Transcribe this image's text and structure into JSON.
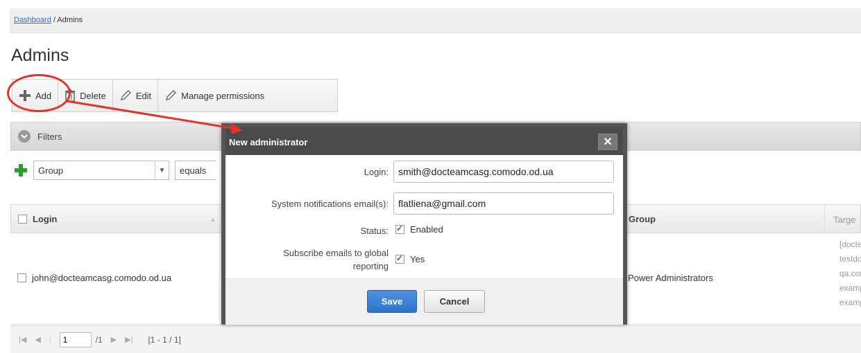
{
  "breadcrumb": {
    "link": "Dashboard",
    "separator": " / ",
    "current": "Admins"
  },
  "page_title": "Admins",
  "toolbar": {
    "add_label": "Add",
    "delete_label": "Delete",
    "edit_label": "Edit",
    "manage_label": "Manage permissions"
  },
  "filters": {
    "title": "Filters",
    "field_value": "Group",
    "operator_value": "equals"
  },
  "table": {
    "columns": [
      "Login",
      "Group",
      "Targe"
    ],
    "rows": [
      {
        "login": "john@docteamcasg.comodo.od.ua",
        "group": "Power Administrators",
        "targets": [
          "[docte",
          "testdo",
          "qa.cor",
          "examp",
          "examp"
        ]
      }
    ]
  },
  "pager": {
    "page_value": "1",
    "total_pages": "/1",
    "range": "[1 - 1 / 1]"
  },
  "modal": {
    "title": "New administrator",
    "close_label": "✕",
    "login_label": "Login:",
    "login_value": "smith@docteamcasg.comodo.od.ua",
    "email_label": "System notifications email(s):",
    "email_value": "flatliena@gmail.com",
    "status_label": "Status:",
    "status_value": "Enabled",
    "subscribe_label_line1": "Subscribe emails to global",
    "subscribe_label_line2": "reporting",
    "subscribe_value": "Yes",
    "save_label": "Save",
    "cancel_label": "Cancel"
  },
  "colors": {
    "annotation_red": "#e6332a",
    "save_blue": "#3a7fd4",
    "add_green": "#2e9e2e",
    "modal_header": "#4a4a4a"
  }
}
